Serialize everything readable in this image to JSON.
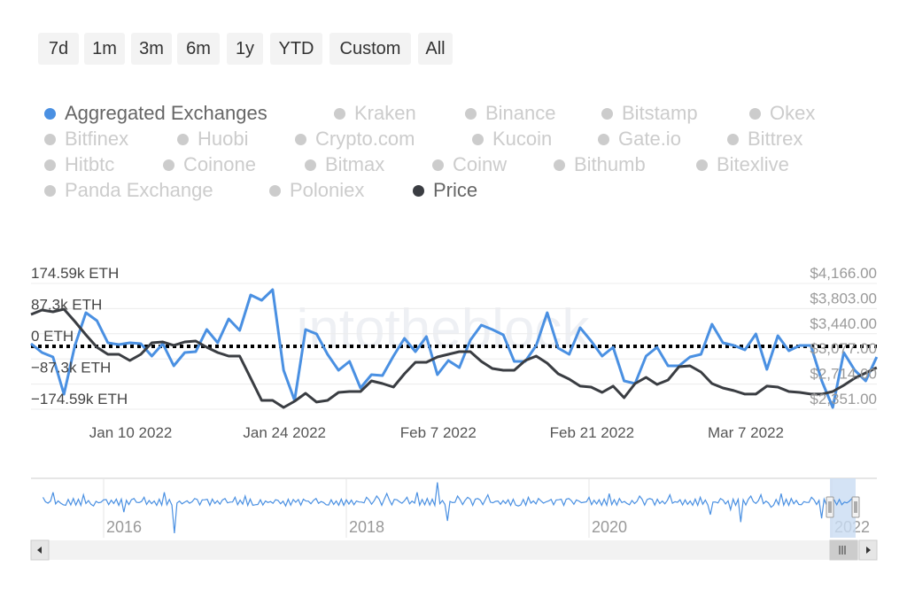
{
  "range_buttons": [
    "7d",
    "1m",
    "3m",
    "6m",
    "1y",
    "YTD",
    "Custom",
    "All"
  ],
  "legend": [
    {
      "label": "Aggregated Exchanges",
      "color": "#4a90e2",
      "active": true
    },
    {
      "label": "Kraken",
      "color": "#cccccc",
      "active": false
    },
    {
      "label": "Binance",
      "color": "#cccccc",
      "active": false
    },
    {
      "label": "Bitstamp",
      "color": "#cccccc",
      "active": false
    },
    {
      "label": "Okex",
      "color": "#cccccc",
      "active": false
    },
    {
      "label": "Bitfinex",
      "color": "#cccccc",
      "active": false
    },
    {
      "label": "Huobi",
      "color": "#cccccc",
      "active": false
    },
    {
      "label": "Crypto.com",
      "color": "#cccccc",
      "active": false
    },
    {
      "label": "Kucoin",
      "color": "#cccccc",
      "active": false
    },
    {
      "label": "Gate.io",
      "color": "#cccccc",
      "active": false
    },
    {
      "label": "Bittrex",
      "color": "#cccccc",
      "active": false
    },
    {
      "label": "Hitbtc",
      "color": "#cccccc",
      "active": false
    },
    {
      "label": "Coinone",
      "color": "#cccccc",
      "active": false
    },
    {
      "label": "Bitmax",
      "color": "#cccccc",
      "active": false
    },
    {
      "label": "Coinw",
      "color": "#cccccc",
      "active": false
    },
    {
      "label": "Bithumb",
      "color": "#cccccc",
      "active": false
    },
    {
      "label": "Bitexlive",
      "color": "#cccccc",
      "active": false
    },
    {
      "label": "Panda Exchange",
      "color": "#cccccc",
      "active": false
    },
    {
      "label": "Poloniex",
      "color": "#cccccc",
      "active": false
    },
    {
      "label": "Price",
      "color": "#3a3d42",
      "active": true
    }
  ],
  "watermark": "intotheblock",
  "chart_data": [
    {
      "type": "line",
      "x_type": "date",
      "x_ticks": [
        "Jan 10 2022",
        "Jan 24 2022",
        "Feb 7 2022",
        "Feb 21 2022",
        "Mar 7 2022"
      ],
      "y_left_ticks": [
        "174.59k ETH",
        "87.3k ETH",
        "0 ETH",
        "−87.3k ETH",
        "−174.59k ETH"
      ],
      "y_left_tick_values": [
        174.59,
        87.3,
        0,
        -87.3,
        -174.59
      ],
      "y_left_unit": "k ETH",
      "y_right_ticks": [
        "$4,166.00",
        "$3,803.00",
        "$3,440.00",
        "$3,077.00",
        "$2,714.00",
        "$2,351.00"
      ],
      "y_right_tick_values": [
        4166,
        3803,
        3440,
        3077,
        2714,
        2351
      ],
      "ylim_left": [
        -174.59,
        174.59
      ],
      "ylim_right": [
        2351,
        4166
      ],
      "zero_line": "dotted",
      "grid": true,
      "legend": "top",
      "x": [
        "2022-01-01",
        "2022-01-02",
        "2022-01-03",
        "2022-01-04",
        "2022-01-05",
        "2022-01-06",
        "2022-01-07",
        "2022-01-08",
        "2022-01-09",
        "2022-01-10",
        "2022-01-11",
        "2022-01-12",
        "2022-01-13",
        "2022-01-14",
        "2022-01-15",
        "2022-01-16",
        "2022-01-17",
        "2022-01-18",
        "2022-01-19",
        "2022-01-20",
        "2022-01-21",
        "2022-01-22",
        "2022-01-23",
        "2022-01-24",
        "2022-01-25",
        "2022-01-26",
        "2022-01-27",
        "2022-01-28",
        "2022-01-29",
        "2022-01-30",
        "2022-01-31",
        "2022-02-01",
        "2022-02-02",
        "2022-02-03",
        "2022-02-04",
        "2022-02-05",
        "2022-02-06",
        "2022-02-07",
        "2022-02-08",
        "2022-02-09",
        "2022-02-10",
        "2022-02-11",
        "2022-02-12",
        "2022-02-13",
        "2022-02-14",
        "2022-02-15",
        "2022-02-16",
        "2022-02-17",
        "2022-02-18",
        "2022-02-19",
        "2022-02-20",
        "2022-02-21",
        "2022-02-22",
        "2022-02-23",
        "2022-02-24",
        "2022-02-25",
        "2022-02-26",
        "2022-02-27",
        "2022-02-28",
        "2022-03-01",
        "2022-03-02",
        "2022-03-03",
        "2022-03-04",
        "2022-03-05",
        "2022-03-06",
        "2022-03-07",
        "2022-03-08",
        "2022-03-09",
        "2022-03-10",
        "2022-03-11",
        "2022-03-12",
        "2022-03-13",
        "2022-03-14",
        "2022-03-15",
        "2022-03-16",
        "2022-03-17",
        "2022-03-18",
        "2022-03-19"
      ],
      "series": [
        {
          "name": "Aggregated Exchanges",
          "axis": "left",
          "color": "#4a90e2",
          "values": [
            7.4,
            -17.2,
            -29.5,
            -132.8,
            2.5,
            93.4,
            71.3,
            9.8,
            4.9,
            9.8,
            7.4,
            -27.0,
            7.4,
            -54.1,
            -17.2,
            -14.8,
            46.7,
            9.8,
            76.2,
            44.3,
            142.6,
            127.9,
            157.4,
            -66.4,
            -150.0,
            46.7,
            34.4,
            -22.1,
            -66.4,
            -41.8,
            -115.6,
            -78.7,
            -81.1,
            -27.0,
            22.1,
            -14.8,
            27.0,
            -78.7,
            -39.3,
            -59.0,
            17.2,
            59.0,
            46.7,
            32.0,
            -41.8,
            -41.8,
            2.5,
            93.4,
            -4.9,
            -22.1,
            51.6,
            14.8,
            -27.0,
            -2.5,
            -95.9,
            -103.3,
            -27.0,
            -2.5,
            -54.1,
            -54.1,
            -29.5,
            -22.1,
            61.5,
            9.8,
            2.5,
            -9.8,
            34.4,
            -63.9,
            29.5,
            -12.3,
            2.5,
            2.5,
            -95.9,
            -169.7,
            -17.2,
            -66.4,
            -95.9,
            -29.5
          ]
        },
        {
          "name": "Price",
          "axis": "right",
          "color": "#3a3d42",
          "values": [
            3719,
            3783,
            3757,
            3795,
            3616,
            3425,
            3246,
            3144,
            3144,
            3054,
            3144,
            3310,
            3323,
            3272,
            3323,
            3335,
            3246,
            3169,
            3118,
            3118,
            2799,
            2479,
            2479,
            2377,
            2466,
            2581,
            2454,
            2479,
            2594,
            2607,
            2607,
            2760,
            2722,
            2671,
            2862,
            3029,
            3029,
            3105,
            3144,
            3182,
            3182,
            3041,
            2939,
            2914,
            2914,
            3054,
            3118,
            3016,
            2862,
            2786,
            2684,
            2671,
            2594,
            2684,
            2517,
            2722,
            2811,
            2709,
            2773,
            2965,
            2977,
            2888,
            2722,
            2658,
            2620,
            2569,
            2569,
            2684,
            2671,
            2607,
            2594,
            2569,
            2569,
            2607,
            2696,
            2799,
            2875,
            2952
          ]
        }
      ]
    },
    {
      "type": "line",
      "role": "navigator",
      "x_ticks": [
        "2016",
        "2018",
        "2020",
        "2022"
      ],
      "selected_range": [
        "2022-01-01",
        "2022-03-19"
      ],
      "x": [
        "2015-07",
        "2015-08",
        "2015-09",
        "2015-10",
        "2015-11",
        "2015-12",
        "2016-01",
        "2016-02",
        "2016-03",
        "2016-04",
        "2016-05",
        "2016-06",
        "2016-07",
        "2016-08",
        "2016-09",
        "2016-10",
        "2016-11",
        "2016-12",
        "2017-01",
        "2017-02",
        "2017-03",
        "2017-04",
        "2017-05",
        "2017-06",
        "2017-07",
        "2017-08",
        "2017-09",
        "2017-10",
        "2017-11",
        "2017-12",
        "2018-01",
        "2018-02",
        "2018-03",
        "2018-04",
        "2018-05",
        "2018-06",
        "2018-07",
        "2018-08",
        "2018-09",
        "2018-10",
        "2018-11",
        "2018-12",
        "2019-01",
        "2019-02",
        "2019-03",
        "2019-04",
        "2019-05",
        "2019-06",
        "2019-07",
        "2019-08",
        "2019-09",
        "2019-10",
        "2019-11",
        "2019-12",
        "2020-01",
        "2020-02",
        "2020-03",
        "2020-04",
        "2020-05",
        "2020-06",
        "2020-07",
        "2020-08",
        "2020-09",
        "2020-10",
        "2020-11",
        "2020-12",
        "2021-01",
        "2021-02",
        "2021-03",
        "2021-04",
        "2021-05",
        "2021-06",
        "2021-07",
        "2021-08",
        "2021-09",
        "2021-10",
        "2021-11",
        "2021-12",
        "2022-01",
        "2022-02",
        "2022-03"
      ],
      "series": [
        {
          "color": "#4a90e2",
          "values": [
            40,
            80,
            -20,
            30,
            60,
            -30,
            20,
            -10,
            -80,
            30,
            40,
            10,
            80,
            -250,
            0,
            30,
            20,
            -10,
            30,
            40,
            50,
            -20,
            10,
            20,
            -30,
            0,
            10,
            30,
            -20,
            10,
            20,
            10,
            40,
            50,
            70,
            20,
            40,
            80,
            30,
            160,
            -150,
            50,
            40,
            30,
            60,
            10,
            20,
            -30,
            40,
            30,
            10,
            20,
            30,
            10,
            40,
            20,
            70,
            30,
            -20,
            50,
            30,
            -10,
            60,
            20,
            10,
            40,
            -100,
            30,
            -60,
            -160,
            50,
            60,
            -40,
            70,
            30,
            -20,
            40,
            -130,
            10,
            -20,
            30
          ]
        }
      ]
    }
  ]
}
